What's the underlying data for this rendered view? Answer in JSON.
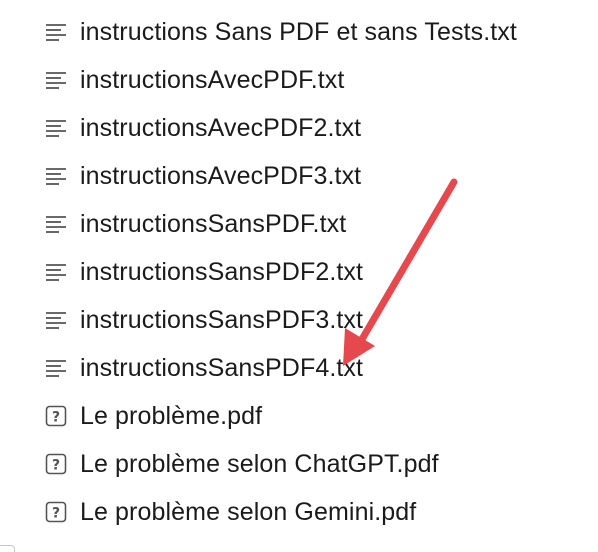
{
  "files": [
    {
      "name": "instructions Sans PDF et sans Tests.txt",
      "icon": "text-file-icon"
    },
    {
      "name": "instructionsAvecPDF.txt",
      "icon": "text-file-icon"
    },
    {
      "name": "instructionsAvecPDF2.txt",
      "icon": "text-file-icon"
    },
    {
      "name": "instructionsAvecPDF3.txt",
      "icon": "text-file-icon"
    },
    {
      "name": "instructionsSansPDF.txt",
      "icon": "text-file-icon"
    },
    {
      "name": "instructionsSansPDF2.txt",
      "icon": "text-file-icon"
    },
    {
      "name": "instructionsSansPDF3.txt",
      "icon": "text-file-icon"
    },
    {
      "name": "instructionsSansPDF4.txt",
      "icon": "text-file-icon"
    },
    {
      "name": "Le problème.pdf",
      "icon": "unknown-file-icon"
    },
    {
      "name": "Le problème selon ChatGPT.pdf",
      "icon": "unknown-file-icon"
    },
    {
      "name": "Le problème selon Gemini.pdf",
      "icon": "unknown-file-icon"
    }
  ],
  "annotation": {
    "points_to_index": 7,
    "color": "#e5484d"
  },
  "colors": {
    "text": "#1b1b1b",
    "icon": "#555555",
    "background": "#ffffff"
  }
}
